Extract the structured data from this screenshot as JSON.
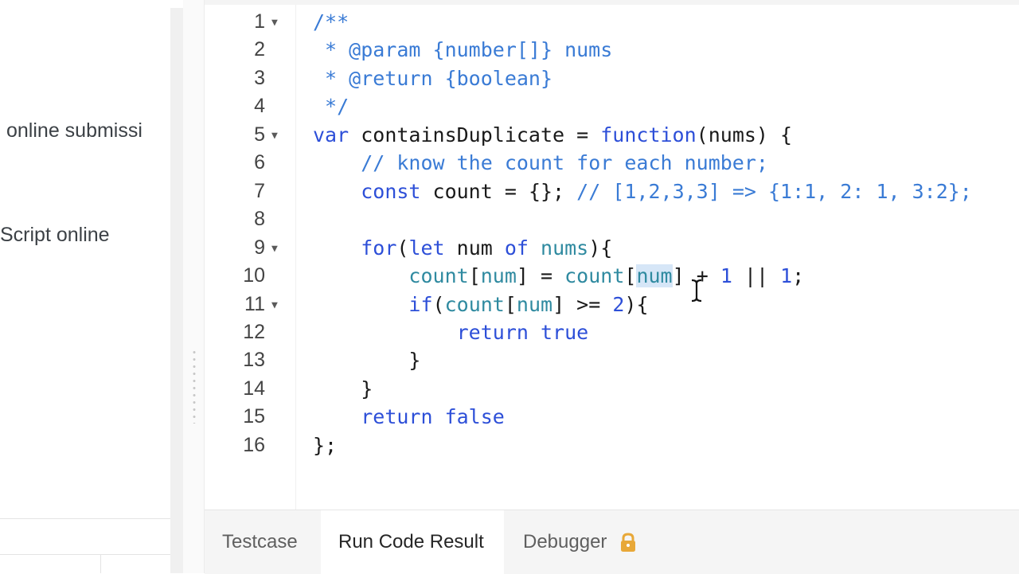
{
  "description_panel": {
    "text_1": "online submissi",
    "text_2": "Script online"
  },
  "editor": {
    "lines": [
      {
        "n": "1",
        "fold": true,
        "tokens": [
          [
            "comment",
            "/**"
          ]
        ]
      },
      {
        "n": "2",
        "fold": false,
        "tokens": [
          [
            "comment",
            " * @param {number[]} nums"
          ]
        ]
      },
      {
        "n": "3",
        "fold": false,
        "tokens": [
          [
            "comment",
            " * @return {boolean}"
          ]
        ]
      },
      {
        "n": "4",
        "fold": false,
        "tokens": [
          [
            "comment",
            " */"
          ]
        ]
      },
      {
        "n": "5",
        "fold": true,
        "tokens": [
          [
            "kw",
            "var "
          ],
          [
            "plain",
            "containsDuplicate = "
          ],
          [
            "kw",
            "function"
          ],
          [
            "plain",
            "(nums) {"
          ]
        ]
      },
      {
        "n": "6",
        "fold": false,
        "tokens": [
          [
            "plain",
            "    "
          ],
          [
            "comment",
            "// know the count for each number;"
          ]
        ]
      },
      {
        "n": "7",
        "fold": false,
        "tokens": [
          [
            "plain",
            "    "
          ],
          [
            "kw",
            "const "
          ],
          [
            "plain",
            "count = {}; "
          ],
          [
            "comment",
            "// [1,2,3,3] => {1:1, 2: 1, 3:2};"
          ]
        ]
      },
      {
        "n": "8",
        "fold": false,
        "tokens": [
          [
            "plain",
            ""
          ]
        ]
      },
      {
        "n": "9",
        "fold": true,
        "tokens": [
          [
            "plain",
            "    "
          ],
          [
            "kw",
            "for"
          ],
          [
            "plain",
            "("
          ],
          [
            "kw",
            "let "
          ],
          [
            "plain",
            "num "
          ],
          [
            "kw",
            "of "
          ],
          [
            "var",
            "nums"
          ],
          [
            "plain",
            "){"
          ]
        ]
      },
      {
        "n": "10",
        "fold": false,
        "tokens": [
          [
            "plain",
            "        "
          ],
          [
            "var",
            "count"
          ],
          [
            "plain",
            "["
          ],
          [
            "var",
            "num"
          ],
          [
            "plain",
            "] = "
          ],
          [
            "var",
            "count"
          ],
          [
            "plain",
            "["
          ],
          [
            "hl",
            "num"
          ],
          [
            "plain",
            "] + "
          ],
          [
            "num",
            "1"
          ],
          [
            "plain",
            " || "
          ],
          [
            "num",
            "1"
          ],
          [
            "plain",
            ";"
          ]
        ]
      },
      {
        "n": "11",
        "fold": true,
        "tokens": [
          [
            "plain",
            "        "
          ],
          [
            "kw",
            "if"
          ],
          [
            "plain",
            "("
          ],
          [
            "var",
            "count"
          ],
          [
            "plain",
            "["
          ],
          [
            "var",
            "num"
          ],
          [
            "plain",
            "] >= "
          ],
          [
            "num",
            "2"
          ],
          [
            "plain",
            "){"
          ]
        ]
      },
      {
        "n": "12",
        "fold": false,
        "tokens": [
          [
            "plain",
            "            "
          ],
          [
            "kw",
            "return "
          ],
          [
            "kw",
            "true"
          ]
        ]
      },
      {
        "n": "13",
        "fold": false,
        "tokens": [
          [
            "plain",
            "        }"
          ]
        ]
      },
      {
        "n": "14",
        "fold": false,
        "tokens": [
          [
            "plain",
            "    }"
          ]
        ]
      },
      {
        "n": "15",
        "fold": false,
        "tokens": [
          [
            "plain",
            "    "
          ],
          [
            "kw",
            "return "
          ],
          [
            "kw",
            "false"
          ]
        ]
      },
      {
        "n": "16",
        "fold": false,
        "tokens": [
          [
            "plain",
            "};"
          ]
        ]
      }
    ]
  },
  "bottom_tabs": {
    "testcase": "Testcase",
    "run_code_result": "Run Code Result",
    "debugger": "Debugger"
  },
  "colors": {
    "comment": "#3a7bd5",
    "keyword": "#2d4fd8",
    "variable": "#2f8aa0",
    "selection": "#d6e6f7",
    "lock": "#e8a838"
  },
  "icons": {
    "fold": "triangle-down",
    "lock": "lock-icon",
    "cursor": "text-cursor"
  }
}
